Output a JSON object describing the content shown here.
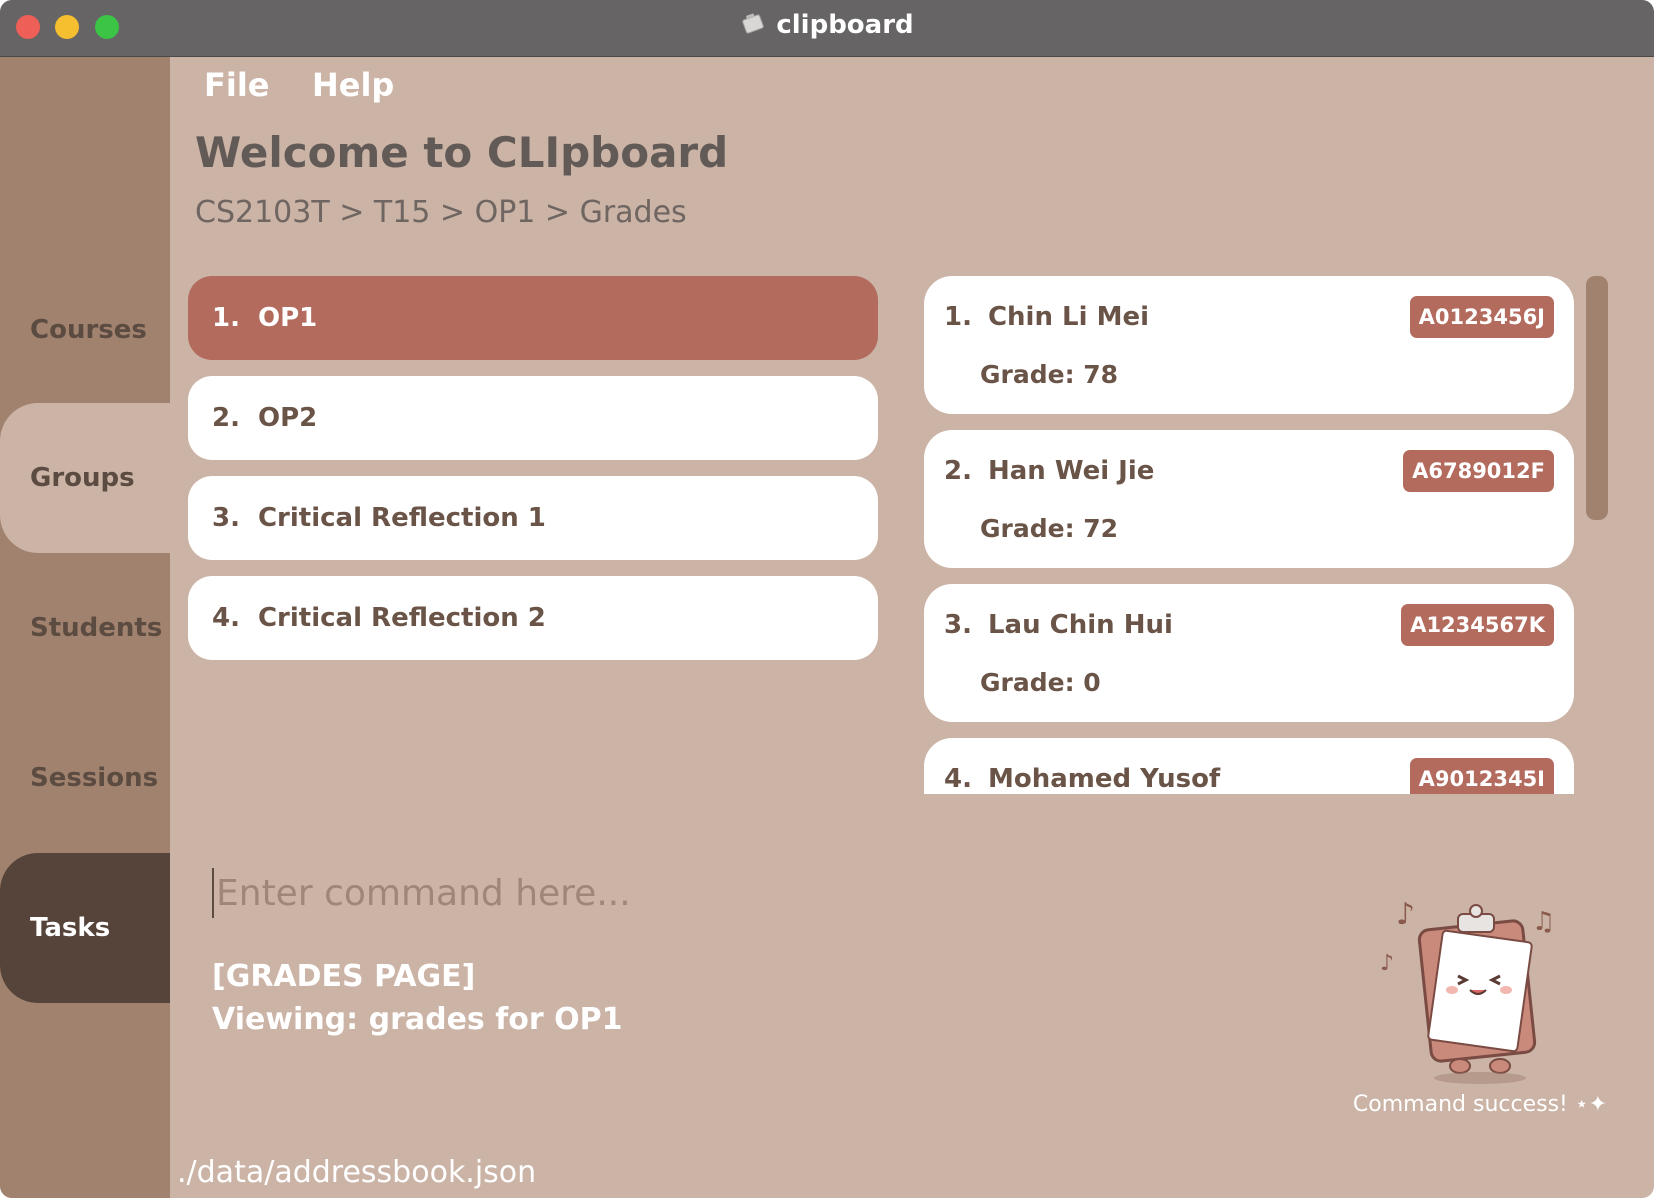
{
  "window": {
    "title": "clipboard"
  },
  "sidebar": {
    "items": [
      {
        "label": "Courses"
      },
      {
        "label": "Groups"
      },
      {
        "label": "Students"
      },
      {
        "label": "Sessions"
      },
      {
        "label": "Tasks"
      }
    ]
  },
  "menu": {
    "file": "File",
    "help": "Help"
  },
  "header": {
    "welcome": "Welcome to CLIpboard",
    "breadcrumb": "CS2103T > T15 > OP1 > Grades"
  },
  "groups": [
    {
      "num": "1.",
      "name": "OP1"
    },
    {
      "num": "2.",
      "name": "OP2"
    },
    {
      "num": "3.",
      "name": "Critical Reflection 1"
    },
    {
      "num": "4.",
      "name": "Critical Reflection 2"
    }
  ],
  "students": [
    {
      "num": "1.",
      "name": "Chin Li Mei",
      "id": "A0123456J",
      "grade": "Grade: 78"
    },
    {
      "num": "2.",
      "name": "Han Wei Jie",
      "id": "A6789012F",
      "grade": "Grade: 72"
    },
    {
      "num": "3.",
      "name": "Lau Chin Hui",
      "id": "A1234567K",
      "grade": "Grade: 0"
    },
    {
      "num": "4.",
      "name": "Mohamed Yusof",
      "id": "A9012345I",
      "grade": ""
    }
  ],
  "command": {
    "placeholder": "Enter command here...",
    "result_line1": "[GRADES PAGE]",
    "result_line2": "Viewing: grades for OP1"
  },
  "mascot": {
    "caption": "Command success! ⋆✦"
  },
  "status": {
    "filepath": "./data/addressbook.json"
  },
  "colors": {
    "background": "#cbb3a6",
    "sidebar": "#a1826f",
    "sidebar_active_dark": "#56443a",
    "accent": "#b36b5e",
    "card": "#ffffff",
    "text_brown": "#6a5447"
  }
}
